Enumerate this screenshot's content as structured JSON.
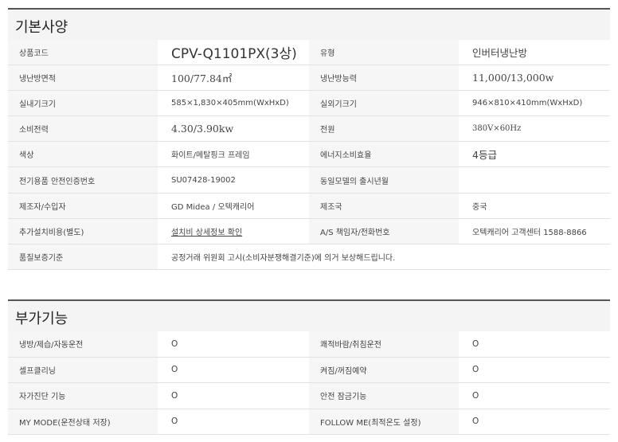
{
  "basic": {
    "title": "기본사양",
    "rows": [
      [
        {
          "label": "상품코드",
          "value": "CPV-Q1101PX(3상)"
        },
        {
          "label": "유형",
          "value": "인버터냉난방"
        }
      ],
      [
        {
          "label": "냉난방면적",
          "value": "100/77.84㎡"
        },
        {
          "label": "냉난방능력",
          "value": "11,000/13,000w"
        }
      ],
      [
        {
          "label": "실내기크기",
          "value": "585×1,830×405mm(WxHxD)"
        },
        {
          "label": "실외기크기",
          "value": "946×810×410mm(WxHxD)"
        }
      ],
      [
        {
          "label": "소비전력",
          "value": "4.30/3.90kw"
        },
        {
          "label": "전원",
          "value": "380V×60Hz"
        }
      ],
      [
        {
          "label": "색상",
          "value": "화이트/메탈핑크 프레임"
        },
        {
          "label": "에너지소비효율",
          "value": "4등급"
        }
      ],
      [
        {
          "label": "전기용품 안전인증번호",
          "value": "SU07428-19002"
        },
        {
          "label": "동일모델의 출시년월",
          "value": ""
        }
      ],
      [
        {
          "label": "제조자/수입자",
          "value": "GD Midea / 오텍캐리어"
        },
        {
          "label": "제조국",
          "value": "중국"
        }
      ],
      [
        {
          "label": "추가설치비용(별도)",
          "value": "설치비 상세정보 확인"
        },
        {
          "label": "A/S 책임자/전화번호",
          "value": "오텍캐리어 고객센터 1588-8866"
        }
      ],
      [
        {
          "label": "품질보증기준",
          "value": "공정거래 위원회 고시(소비자분쟁해결기준)에 의거 보상해드립니다."
        }
      ]
    ]
  },
  "functions": {
    "title": "부가기능",
    "rows": [
      [
        {
          "label": "냉방/제습/자동운전",
          "value": "O"
        },
        {
          "label": "쾌적바람/취침운전",
          "value": "O"
        }
      ],
      [
        {
          "label": "셀프클리닝",
          "value": "O"
        },
        {
          "label": "켜짐/꺼짐예약",
          "value": "O"
        }
      ],
      [
        {
          "label": "자가진단 기능",
          "value": "O"
        },
        {
          "label": "안전 잠금기능",
          "value": "O"
        }
      ],
      [
        {
          "label": "MY MODE(운전상태 저장)",
          "value": "O"
        },
        {
          "label": "FOLLOW ME(최적온도 설정)",
          "value": "O"
        }
      ]
    ]
  }
}
